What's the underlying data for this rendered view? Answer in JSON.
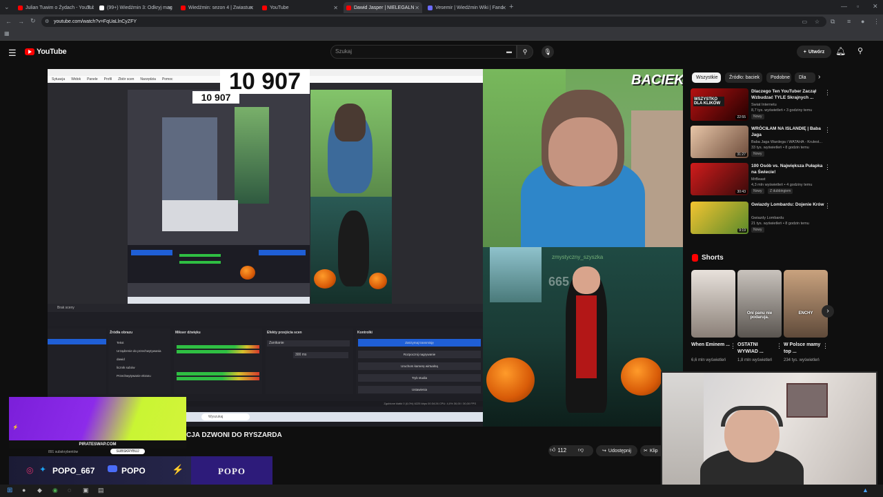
{
  "browser": {
    "tabs": [
      {
        "label": "Julian Tuwim o Żydach - YouTub",
        "fav": "#ff0000"
      },
      {
        "label": "(99+) Wiedźmin 3: Odkryj mag",
        "fav": "#ffffff"
      },
      {
        "label": "Wiedźmin: sezon 4 | Zwiastun",
        "fav": "#ff0000"
      },
      {
        "label": "YouTube",
        "fav": "#ff0000"
      },
      {
        "label": "Dawid Jasper | NIELEGALN",
        "fav": "#ff0000"
      },
      {
        "label": "Vesemir | Wiedźmin Wiki | Fand",
        "fav": "#6b6bff"
      }
    ],
    "url": "youtube.com/watch?v=FqUaLlnCyZFY"
  },
  "header": {
    "logo_text": "YouTube",
    "search_placeholder": "Szukaj",
    "create_label": "Utwórz"
  },
  "video": {
    "counter_overlay": "10 907",
    "counter_small": "10 907",
    "streamer_logo": "BACIEK",
    "cam_overlay_text": "665",
    "cam_overlay_name": "zmystyczny_szyszka",
    "obs_menu": [
      "Sytuacja",
      "Widok",
      "Panele",
      "Profil",
      "Zbiór scen",
      "Narzędzia",
      "Pomoc"
    ],
    "obs_panels": [
      "Źródła obrazu",
      "Mikser dźwięku",
      "Efekty przejścia scen",
      "Kontrolki"
    ],
    "obs_sources": [
      "Tekst",
      "Urządzenie do przechwytywania",
      "dawid",
      "licznik subów",
      "Przechwytywanie ekranu"
    ],
    "obs_buttons": [
      "Zatrzymaj transmisję",
      "Rozpocznij nagrywanie",
      "Uruchom kamerę wirtualną",
      "Tryb studia",
      "Ustawienia"
    ],
    "obs_transition": "Zanikanie",
    "obs_duration": "300 ms",
    "obs_status": "Zgubione klatki 0 (0,0%)   6225 kbps   00:34:26   CPU: 4,0%   30,00 / 30,00 FPS",
    "obs_search": "Wyszukaj",
    "obs_dock": "Brak sceny",
    "title_partial": "CJA DZWONI DO RYSZARDA",
    "likes": "112",
    "share_label": "Udostępnij",
    "clip_label": "Klip"
  },
  "sidebar": {
    "chips": [
      "Wszystkie",
      "Źródło: baciek",
      "Podobne",
      "Dla"
    ],
    "recommendations": [
      {
        "title": "Dlaczego Ten YouTuber Zaczął Wzbudzać TYLE Skrajnych ...",
        "channel": "Świat Internetu",
        "views": "8,7 tys. wyświetleń • 3 godziny temu",
        "badge": "Nowy",
        "duration": "22:55",
        "thumb_text": "WSZYSTKO DLA KLIKÓW",
        "c1": "#b51111",
        "c2": "#220000"
      },
      {
        "title": "WRÓCIŁAM NA ISLANDIĘ | Baba Jaga",
        "channel": "Baba Jaga Wardega i WATAHA - Krulest...",
        "views": "33 tys. wyświetleń • 8 godzin temu",
        "badge": "Nowy",
        "duration": "31:27",
        "thumb_text": "",
        "c1": "#e8c6a8",
        "c2": "#6d4c3b"
      },
      {
        "title": "100 Osób vs. Największa Pułapka na Świecie!",
        "channel": "MrBeast",
        "views": "4,3 mln wyświetleń • 4 godziny temu",
        "badge": "Nowy",
        "badge2": "Z dubbingiem",
        "duration": "30:43",
        "thumb_text": "",
        "c1": "#d11c1c",
        "c2": "#3a0a0a"
      },
      {
        "title": "Gwiazdy Lombardu: Dojenie Krów",
        "channel": "Gwiazdy Lombardu",
        "views": "21 tys. wyświetleń • 8 godzin temu",
        "badge": "Nowy",
        "duration": "9:19",
        "thumb_text": "",
        "c1": "#f3c431",
        "c2": "#5a8a2a"
      }
    ],
    "shorts_title": "Shorts",
    "shorts": [
      {
        "title": "When Eminem ...",
        "views": "6,6 mln wyświetleń",
        "c1": "#e8e2dc",
        "c2": "#8a7f77",
        "caption": ""
      },
      {
        "title": "OSTATNI WYWIAD ...",
        "views": "1,8 mln wyświetleń",
        "c1": "#c9c3bd",
        "c2": "#5a5550",
        "caption": "Oni panu nie podaruja."
      },
      {
        "title": "W Polsce mamy top ...",
        "views": "234 tys. wyświetleń",
        "c1": "#c9a27e",
        "c2": "#5f4a3a",
        "caption": "ENCHY"
      }
    ]
  },
  "overlay": {
    "promo_site": "PIRATESWAP.COM",
    "promo_sub": "SUBSKRYBUJ",
    "promo_subs": "891 subskrybentów",
    "social_handle_1": "POPO_667",
    "social_handle_2": "POPO",
    "social_brand": "POPO"
  },
  "colors": {
    "yt_red": "#ff0000",
    "obs_blue": "#1f5fd6",
    "chip_active_bg": "#f1f1f1"
  }
}
